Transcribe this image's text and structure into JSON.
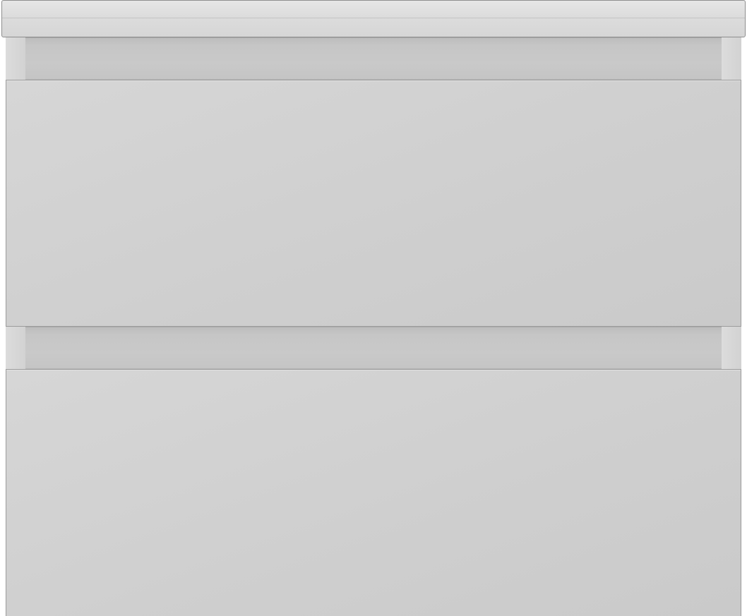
{
  "scene": {
    "subject": "wall-mounted-vanity-cabinet",
    "drawer_count": 2,
    "colors": {
      "body": "#cfcfcf",
      "countertop": "#dcdcdc",
      "recess": "#c6c6c6",
      "outline": "#9c9c9c"
    }
  }
}
